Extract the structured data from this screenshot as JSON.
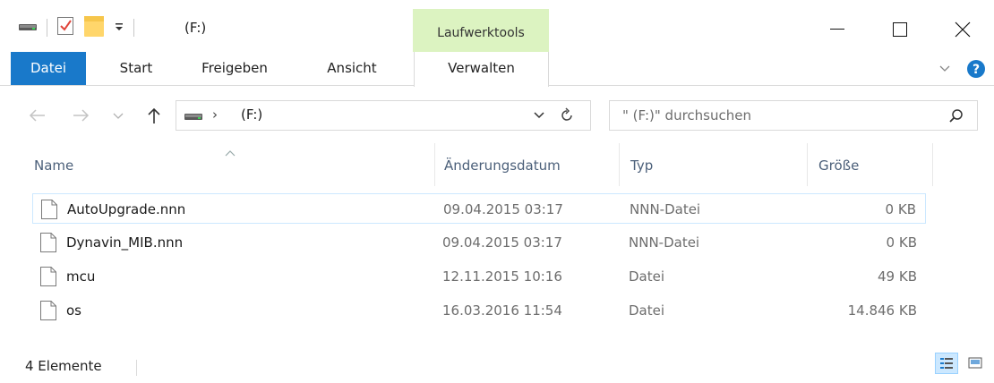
{
  "window": {
    "title": "(F:)",
    "context_tab_label": "Laufwerktools"
  },
  "ribbon": {
    "tabs": [
      "Datei",
      "Start",
      "Freigeben",
      "Ansicht",
      "Verwalten"
    ]
  },
  "address": {
    "path": "(F:)",
    "search_placeholder": "\" (F:)\" durchsuchen"
  },
  "columns": {
    "name": "Name",
    "date": "Änderungsdatum",
    "type": "Typ",
    "size": "Größe"
  },
  "files": [
    {
      "name": "AutoUpgrade.nnn",
      "date": "09.04.2015 03:17",
      "type": "NNN-Datei",
      "size": "0 KB"
    },
    {
      "name": "Dynavin_MIB.nnn",
      "date": "09.04.2015 03:17",
      "type": "NNN-Datei",
      "size": "0 KB"
    },
    {
      "name": "mcu",
      "date": "12.11.2015 10:16",
      "type": "Datei",
      "size": "49 KB"
    },
    {
      "name": "os",
      "date": "16.03.2016 11:54",
      "type": "Datei",
      "size": "14.846 KB"
    }
  ],
  "status": {
    "item_count": "4 Elemente"
  },
  "colors": {
    "accent": "#1979ca",
    "context_tab_bg": "#dcf3c1",
    "header_text": "#4c607a",
    "selection_border": "#cce8ff",
    "help_icon": "#1979ca"
  },
  "icons": {
    "drive": "drive-icon",
    "properties": "properties-checkbox-icon",
    "new_folder": "new-folder-icon",
    "customize": "customize-quick-access-icon",
    "minimize": "minimize-icon",
    "maximize": "maximize-icon",
    "close": "close-icon",
    "expand_ribbon": "chevron-down-icon",
    "help": "help-icon",
    "back": "back-arrow-icon",
    "forward": "forward-arrow-icon",
    "recent": "recent-locations-chevron-icon",
    "up": "up-arrow-icon",
    "refresh": "refresh-icon",
    "search": "search-icon",
    "file": "file-icon",
    "details_view": "details-view-icon",
    "large_icons_view": "large-icons-view-icon"
  }
}
